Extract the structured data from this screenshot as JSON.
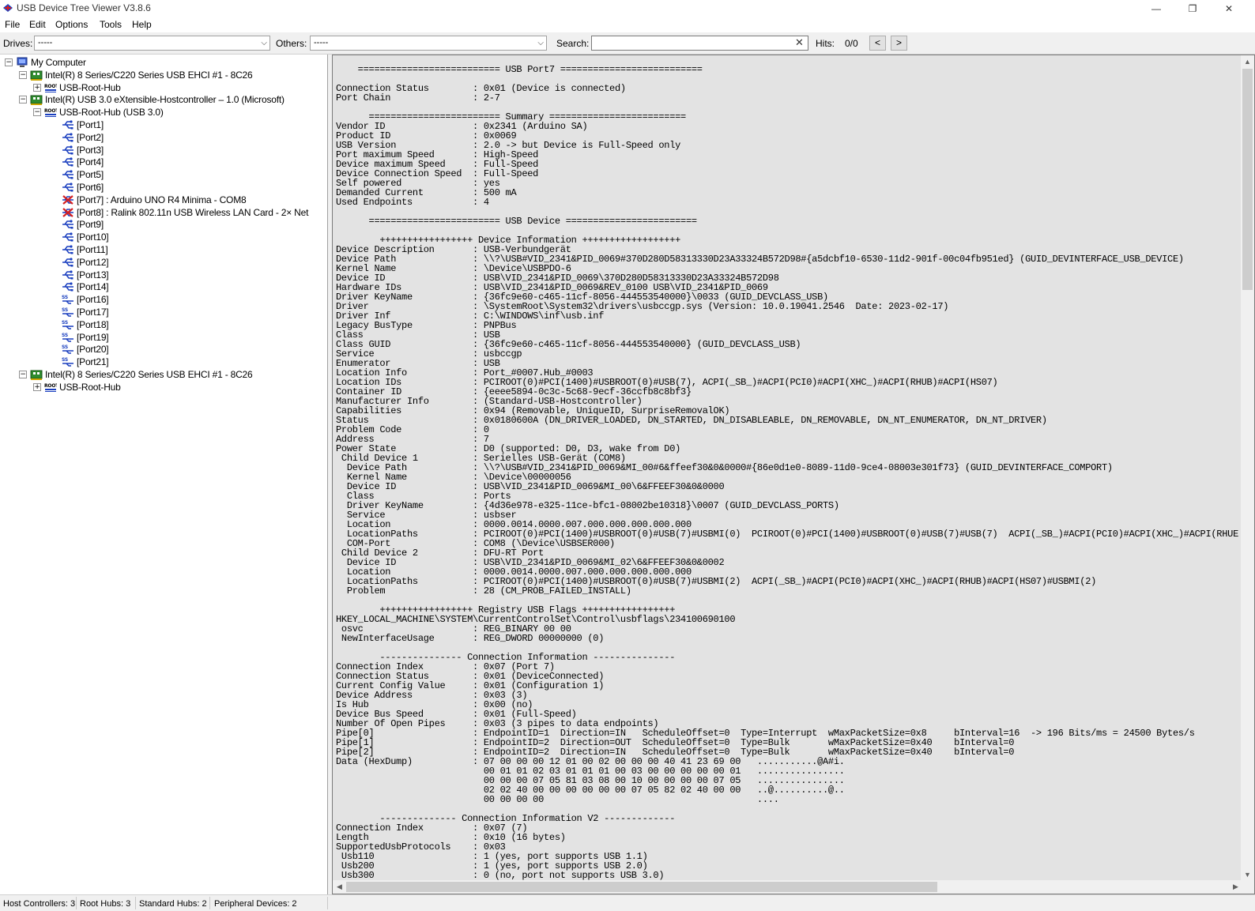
{
  "window": {
    "title": "USB Device Tree Viewer V3.8.6",
    "controls": [
      "—",
      "❐",
      "✕"
    ]
  },
  "menu": [
    "File",
    "Edit",
    "Options",
    "Tools",
    "Help"
  ],
  "toolbar": {
    "drives_label": "Drives:",
    "drives_value": "-----",
    "others_label": "Others:",
    "others_value": "-----",
    "search_label": "Search:",
    "search_value": "",
    "hits_label": "Hits:",
    "hits_value": "0/0",
    "prev": "<",
    "next": ">"
  },
  "tree": [
    {
      "label": "My Computer",
      "level": 0,
      "expander": "−",
      "icon": "computer"
    },
    {
      "label": "Intel(R) 8 Series/C220 Series USB EHCI #1 - 8C26",
      "level": 1,
      "expander": "−",
      "icon": "controller"
    },
    {
      "label": "USB-Root-Hub",
      "level": 2,
      "expander": "+",
      "icon": "root-hub"
    },
    {
      "label": "Intel(R) USB 3.0 eXtensible-Hostcontroller – 1.0 (Microsoft)",
      "level": 1,
      "expander": "−",
      "icon": "controller"
    },
    {
      "label": "USB-Root-Hub (USB 3.0)",
      "level": 2,
      "expander": "−",
      "icon": "root-hub"
    },
    {
      "label": "[Port1]",
      "level": 3,
      "icon": "port"
    },
    {
      "label": "[Port2]",
      "level": 3,
      "icon": "port"
    },
    {
      "label": "[Port3]",
      "level": 3,
      "icon": "port"
    },
    {
      "label": "[Port4]",
      "level": 3,
      "icon": "port"
    },
    {
      "label": "[Port5]",
      "level": 3,
      "icon": "port"
    },
    {
      "label": "[Port6]",
      "level": 3,
      "icon": "port"
    },
    {
      "label": "[Port7] : Arduino UNO R4 Minima - COM8",
      "level": 3,
      "icon": "device-error"
    },
    {
      "label": "[Port8] : Ralink 802.11n USB Wireless LAN Card - 2× Net",
      "level": 3,
      "icon": "device-error"
    },
    {
      "label": "[Port9]",
      "level": 3,
      "icon": "port"
    },
    {
      "label": "[Port10]",
      "level": 3,
      "icon": "port"
    },
    {
      "label": "[Port11]",
      "level": 3,
      "icon": "port"
    },
    {
      "label": "[Port12]",
      "level": 3,
      "icon": "port"
    },
    {
      "label": "[Port13]",
      "level": 3,
      "icon": "port"
    },
    {
      "label": "[Port14]",
      "level": 3,
      "icon": "port"
    },
    {
      "label": "[Port16]",
      "level": 3,
      "icon": "port-ss"
    },
    {
      "label": "[Port17]",
      "level": 3,
      "icon": "port-ss"
    },
    {
      "label": "[Port18]",
      "level": 3,
      "icon": "port-ss"
    },
    {
      "label": "[Port19]",
      "level": 3,
      "icon": "port-ss"
    },
    {
      "label": "[Port20]",
      "level": 3,
      "icon": "port-ss"
    },
    {
      "label": "[Port21]",
      "level": 3,
      "icon": "port-ss"
    },
    {
      "label": "Intel(R) 8 Series/C220 Series USB EHCI #1 - 8C26",
      "level": 1,
      "expander": "−",
      "icon": "controller"
    },
    {
      "label": "USB-Root-Hub",
      "level": 2,
      "expander": "+",
      "icon": "root-hub"
    }
  ],
  "report_lines": [
    "    ========================== USB Port7 ==========================",
    "",
    "Connection Status        : 0x01 (Device is connected)",
    "Port Chain               : 2-7",
    "",
    "      ======================== Summary =========================",
    "Vendor ID                : 0x2341 (Arduino SA)",
    "Product ID               : 0x0069",
    "USB Version              : 2.0 -> but Device is Full-Speed only",
    "Port maximum Speed       : High-Speed",
    "Device maximum Speed     : Full-Speed",
    "Device Connection Speed  : Full-Speed",
    "Self powered             : yes",
    "Demanded Current         : 500 mA",
    "Used Endpoints           : 4",
    "",
    "      ======================== USB Device ========================",
    "",
    "        +++++++++++++++++ Device Information ++++++++++++++++++",
    "Device Description       : USB-Verbundgerät",
    "Device Path              : \\\\?\\USB#VID_2341&PID_0069#370D280D58313330D23A33324B572D98#{a5dcbf10-6530-11d2-901f-00c04fb951ed} (GUID_DEVINTERFACE_USB_DEVICE)",
    "Kernel Name              : \\Device\\USBPDO-6",
    "Device ID                : USB\\VID_2341&PID_0069\\370D280D58313330D23A33324B572D98",
    "Hardware IDs             : USB\\VID_2341&PID_0069&REV_0100 USB\\VID_2341&PID_0069",
    "Driver KeyName           : {36fc9e60-c465-11cf-8056-444553540000}\\0033 (GUID_DEVCLASS_USB)",
    "Driver                   : \\SystemRoot\\System32\\drivers\\usbccgp.sys (Version: 10.0.19041.2546  Date: 2023-02-17)",
    "Driver Inf               : C:\\WINDOWS\\inf\\usb.inf",
    "Legacy BusType           : PNPBus",
    "Class                    : USB",
    "Class GUID               : {36fc9e60-c465-11cf-8056-444553540000} (GUID_DEVCLASS_USB)",
    "Service                  : usbccgp",
    "Enumerator               : USB",
    "Location Info            : Port_#0007.Hub_#0003",
    "Location IDs             : PCIROOT(0)#PCI(1400)#USBROOT(0)#USB(7), ACPI(_SB_)#ACPI(PCI0)#ACPI(XHC_)#ACPI(RHUB)#ACPI(HS07)",
    "Container ID             : {eeee5894-0c3c-5c68-9ecf-36ccfb8c8bf3}",
    "Manufacturer Info        : (Standard-USB-Hostcontroller)",
    "Capabilities             : 0x94 (Removable, UniqueID, SurpriseRemovalOK)",
    "Status                   : 0x0180600A (DN_DRIVER_LOADED, DN_STARTED, DN_DISABLEABLE, DN_REMOVABLE, DN_NT_ENUMERATOR, DN_NT_DRIVER)",
    "Problem Code             : 0",
    "Address                  : 7",
    "Power State              : D0 (supported: D0, D3, wake from D0)",
    " Child Device 1          : Serielles USB-Gerät (COM8)",
    "  Device Path            : \\\\?\\USB#VID_2341&PID_0069&MI_00#6&ffeef30&0&0000#{86e0d1e0-8089-11d0-9ce4-08003e301f73} (GUID_DEVINTERFACE_COMPORT)",
    "  Kernel Name            : \\Device\\00000056",
    "  Device ID              : USB\\VID_2341&PID_0069&MI_00\\6&FFEEF30&0&0000",
    "  Class                  : Ports",
    "  Driver KeyName         : {4d36e978-e325-11ce-bfc1-08002be10318}\\0007 (GUID_DEVCLASS_PORTS)",
    "  Service                : usbser",
    "  Location               : 0000.0014.0000.007.000.000.000.000.000",
    "  LocationPaths          : PCIROOT(0)#PCI(1400)#USBROOT(0)#USB(7)#USBMI(0)  PCIROOT(0)#PCI(1400)#USBROOT(0)#USB(7)#USB(7)  ACPI(_SB_)#ACPI(PCI0)#ACPI(XHC_)#ACPI(RHUE",
    "  COM-Port               : COM8 (\\Device\\USBSER000)",
    " Child Device 2          : DFU-RT Port",
    "  Device ID              : USB\\VID_2341&PID_0069&MI_02\\6&FFEEF30&0&0002",
    "  Location               : 0000.0014.0000.007.000.000.000.000.000",
    "  LocationPaths          : PCIROOT(0)#PCI(1400)#USBROOT(0)#USB(7)#USBMI(2)  ACPI(_SB_)#ACPI(PCI0)#ACPI(XHC_)#ACPI(RHUB)#ACPI(HS07)#USBMI(2)",
    "  Problem                : 28 (CM_PROB_FAILED_INSTALL)",
    "",
    "        +++++++++++++++++ Registry USB Flags +++++++++++++++++",
    "HKEY_LOCAL_MACHINE\\SYSTEM\\CurrentControlSet\\Control\\usbflags\\234100690100",
    " osvc                    : REG_BINARY 00 00",
    " NewInterfaceUsage       : REG_DWORD 00000000 (0)",
    "",
    "        --------------- Connection Information ---------------",
    "Connection Index         : 0x07 (Port 7)",
    "Connection Status        : 0x01 (DeviceConnected)",
    "Current Config Value     : 0x01 (Configuration 1)",
    "Device Address           : 0x03 (3)",
    "Is Hub                   : 0x00 (no)",
    "Device Bus Speed         : 0x01 (Full-Speed)",
    "Number Of Open Pipes     : 0x03 (3 pipes to data endpoints)",
    "Pipe[0]                  : EndpointID=1  Direction=IN   ScheduleOffset=0  Type=Interrupt  wMaxPacketSize=0x8     bInterval=16  -> 196 Bits/ms = 24500 Bytes/s",
    "Pipe[1]                  : EndpointID=2  Direction=OUT  ScheduleOffset=0  Type=Bulk       wMaxPacketSize=0x40    bInterval=0",
    "Pipe[2]                  : EndpointID=2  Direction=IN   ScheduleOffset=0  Type=Bulk       wMaxPacketSize=0x40    bInterval=0",
    "Data (HexDump)           : 07 00 00 00 12 01 00 02 00 00 00 40 41 23 69 00   ...........@A#i.",
    "                           00 01 01 02 03 01 01 01 00 03 00 00 00 00 00 01   ................",
    "                           00 00 00 07 05 81 03 08 00 10 00 00 00 00 07 05   ................",
    "                           02 02 40 00 00 00 00 00 00 07 05 82 02 40 00 00   ..@..........@..",
    "                           00 00 00 00                                       ....",
    "",
    "        -------------- Connection Information V2 -------------",
    "Connection Index         : 0x07 (7)",
    "Length                   : 0x10 (16 bytes)",
    "SupportedUsbProtocols    : 0x03",
    " Usb110                  : 1 (yes, port supports USB 1.1)",
    " Usb200                  : 1 (yes, port supports USB 2.0)",
    " Usb300                  : 0 (no, port not supports USB 3.0)"
  ],
  "status": {
    "host_controllers": "Host Controllers: 3",
    "root_hubs": "Root Hubs: 3",
    "standard_hubs": "Standard Hubs: 2",
    "peripheral_devices": "Peripheral Devices: 2"
  },
  "colors": {
    "report_background": "#e3e3e3",
    "tree_background": "#ffffff",
    "port_icon": "#1a3fbf",
    "error_icon": "#d61f1f",
    "controller_icon": "#2e8b2e"
  }
}
